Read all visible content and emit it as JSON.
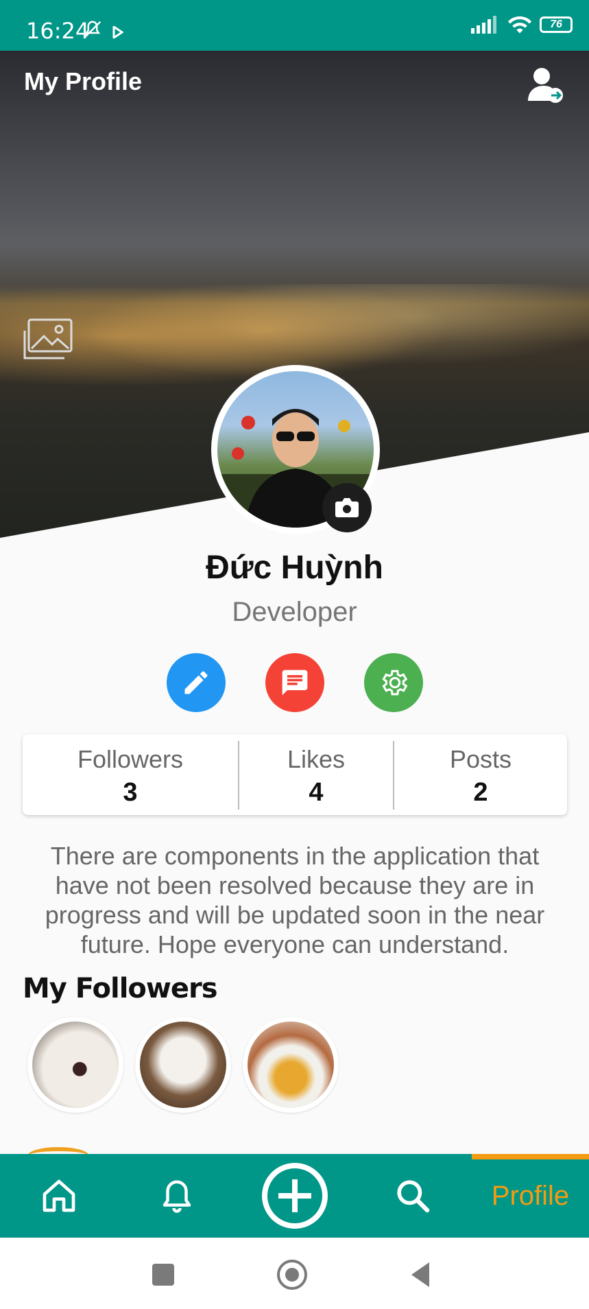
{
  "status_bar": {
    "time": "16:24",
    "battery": "76"
  },
  "header": {
    "title": "My Profile"
  },
  "profile": {
    "name": "Đức Huỳnh",
    "role": "Developer"
  },
  "stats": [
    {
      "label": "Followers",
      "value": "3"
    },
    {
      "label": "Likes",
      "value": "4"
    },
    {
      "label": "Posts",
      "value": "2"
    }
  ],
  "bio": "There are components in the application that have not been resolved because they are in progress and will be updated soon in the near future. Hope everyone can understand.",
  "followers_section": {
    "title": "My Followers"
  },
  "bottom_nav": {
    "active_label": "Profile"
  },
  "colors": {
    "primary": "#009688",
    "accent": "#f39c12",
    "edit": "#2196f3",
    "message": "#f44336",
    "settings": "#4caf50"
  },
  "icons": [
    "home-icon",
    "bell-icon",
    "add-circle-icon",
    "search-icon",
    "logout-icon",
    "gallery-icon",
    "camera-icon",
    "pencil-icon",
    "message-icon",
    "gear-icon"
  ]
}
